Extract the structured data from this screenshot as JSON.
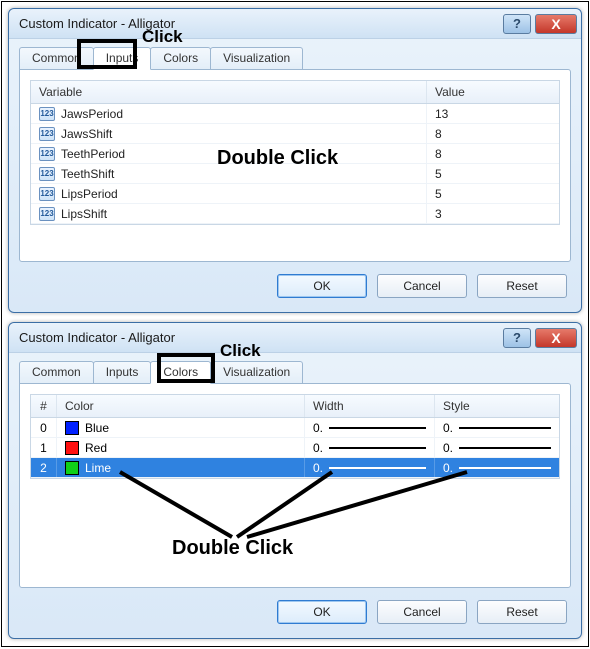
{
  "top": {
    "title": "Custom Indicator - Alligator",
    "tabs": {
      "common": "Common",
      "inputs": "Inputs",
      "colors": "Colors",
      "viz": "Visualization"
    },
    "headers": {
      "variable": "Variable",
      "value": "Value"
    },
    "rows": [
      {
        "name": "JawsPeriod",
        "value": "13"
      },
      {
        "name": "JawsShift",
        "value": "8"
      },
      {
        "name": "TeethPeriod",
        "value": "8"
      },
      {
        "name": "TeethShift",
        "value": "5"
      },
      {
        "name": "LipsPeriod",
        "value": "5"
      },
      {
        "name": "LipsShift",
        "value": "3"
      }
    ],
    "buttons": {
      "ok": "OK",
      "cancel": "Cancel",
      "reset": "Reset"
    }
  },
  "bottom": {
    "title": "Custom Indicator - Alligator",
    "tabs": {
      "common": "Common",
      "inputs": "Inputs",
      "colors": "Colors",
      "viz": "Visualization"
    },
    "headers": {
      "index": "#",
      "color": "Color",
      "width": "Width",
      "style": "Style"
    },
    "rows": [
      {
        "idx": "0",
        "color": "Blue",
        "hex": "#0020ff",
        "width": "0.",
        "style": "0."
      },
      {
        "idx": "1",
        "color": "Red",
        "hex": "#ff1010",
        "width": "0.",
        "style": "0."
      },
      {
        "idx": "2",
        "color": "Lime",
        "hex": "#10d018",
        "width": "0.",
        "style": "0."
      }
    ],
    "buttons": {
      "ok": "OK",
      "cancel": "Cancel",
      "reset": "Reset"
    }
  },
  "annotations": {
    "click1": "Click",
    "dblclick1": "Double Click",
    "click2": "Click",
    "dblclick2": "Double Click"
  },
  "icons": {
    "help": "?",
    "close": "X",
    "int": "123"
  }
}
